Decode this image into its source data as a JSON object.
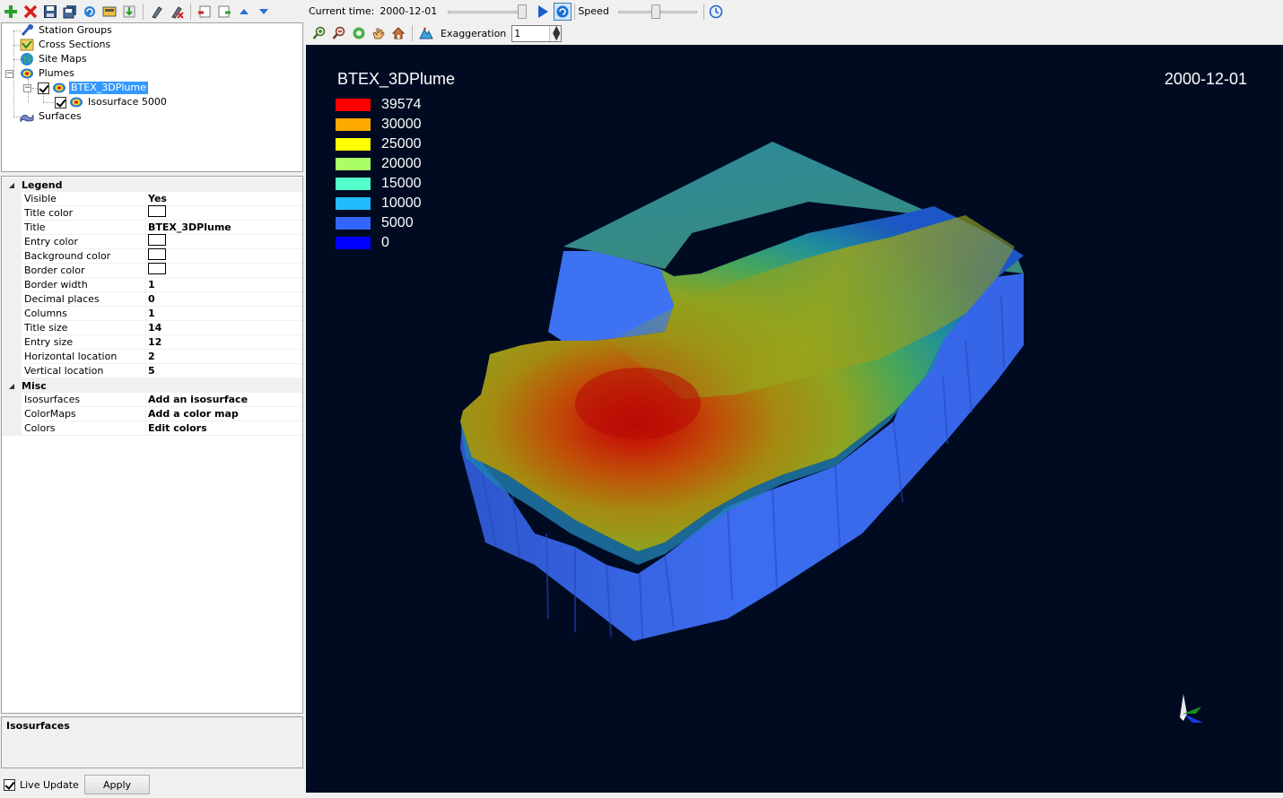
{
  "tree": {
    "items": [
      {
        "label": "Station Groups",
        "icon": "station-groups-icon"
      },
      {
        "label": "Cross Sections",
        "icon": "cross-sections-icon"
      },
      {
        "label": "Site Maps",
        "icon": "globe-icon"
      },
      {
        "label": "Plumes",
        "icon": "plume-icon"
      },
      {
        "label": "BTEX_3DPlume",
        "icon": "plume-icon",
        "selected": true
      },
      {
        "label": "Isosurface 5000",
        "icon": "plume-icon"
      },
      {
        "label": "Surfaces",
        "icon": "surfaces-icon"
      }
    ]
  },
  "properties": {
    "legend_category": "Legend",
    "legend_rows": [
      {
        "name": "Visible",
        "value": "Yes"
      },
      {
        "name": "Title color",
        "value": ""
      },
      {
        "name": "Title",
        "value": "BTEX_3DPlume"
      },
      {
        "name": "Entry color",
        "value": ""
      },
      {
        "name": "Background color",
        "value": ""
      },
      {
        "name": "Border color",
        "value": ""
      },
      {
        "name": "Border width",
        "value": "1"
      },
      {
        "name": "Decimal places",
        "value": "0"
      },
      {
        "name": "Columns",
        "value": "1"
      },
      {
        "name": "Title size",
        "value": "14"
      },
      {
        "name": "Entry size",
        "value": "12"
      },
      {
        "name": "Horizontal location",
        "value": "2"
      },
      {
        "name": "Vertical location",
        "value": "5"
      }
    ],
    "misc_category": "Misc",
    "misc_rows": [
      {
        "name": "Isosurfaces",
        "value": "Add an isosurface"
      },
      {
        "name": "ColorMaps",
        "value": "Add a color map"
      },
      {
        "name": "Colors",
        "value": "Edit colors"
      }
    ]
  },
  "description": {
    "title": "Isosurfaces"
  },
  "bottom": {
    "live_update_label": "Live Update",
    "apply_label": "Apply"
  },
  "time_toolbar": {
    "current_time_label": "Current time:",
    "current_time_value": "2000-12-01",
    "speed_label": "Speed",
    "time_slider_position": 1.0,
    "speed_slider_position": 0.5
  },
  "view_toolbar": {
    "exaggeration_label": "Exaggeration",
    "exaggeration_value": "1"
  },
  "viewport": {
    "title": "BTEX_3DPlume",
    "date": "2000-12-01",
    "background": "#000b22",
    "legend": [
      {
        "label": "39574",
        "color": "#ff0000"
      },
      {
        "label": "30000",
        "color": "#ffaa00"
      },
      {
        "label": "25000",
        "color": "#ffff00"
      },
      {
        "label": "20000",
        "color": "#aaff66"
      },
      {
        "label": "15000",
        "color": "#55ffcc"
      },
      {
        "label": "10000",
        "color": "#22bbff"
      },
      {
        "label": "5000",
        "color": "#3366ff"
      },
      {
        "label": "0",
        "color": "#0000ff"
      }
    ]
  }
}
